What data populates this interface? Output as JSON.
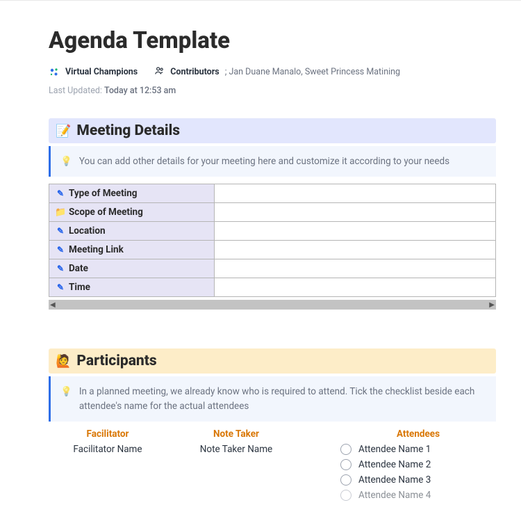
{
  "title": "Agenda Template",
  "workspace": "Virtual Champions",
  "contributors_label": "Contributors",
  "contributors_value": "; Jan Duane Manalo, Sweet Princess Matining",
  "updated_label": "Last Updated: ",
  "updated_value": "Today at 12:53 am",
  "sections": {
    "details": {
      "heading": "Meeting Details",
      "callout": "You can add other details for your meeting here and customize it according to your needs",
      "rows": [
        {
          "icon": "pencil",
          "label": "Type of Meeting",
          "value": ""
        },
        {
          "icon": "folder",
          "label": "Scope of Meeting",
          "value": ""
        },
        {
          "icon": "pencil",
          "label": "Location",
          "value": ""
        },
        {
          "icon": "pencil",
          "label": "Meeting Link",
          "value": ""
        },
        {
          "icon": "pencil",
          "label": "Date",
          "value": ""
        },
        {
          "icon": "pencil",
          "label": "Time",
          "value": ""
        }
      ]
    },
    "participants": {
      "heading": "Participants",
      "callout": "In a planned meeting, we already know who is required to attend. Tick the checklist beside each attendee's name for the actual attendees",
      "facilitator_label": "Facilitator",
      "facilitator_value": "Facilitator Name",
      "notetaker_label": "Note Taker",
      "notetaker_value": "Note Taker Name",
      "attendees_label": "Attendees",
      "attendees": [
        "Attendee Name 1",
        "Attendee Name 2",
        "Attendee Name 3",
        "Attendee Name 4"
      ]
    }
  }
}
